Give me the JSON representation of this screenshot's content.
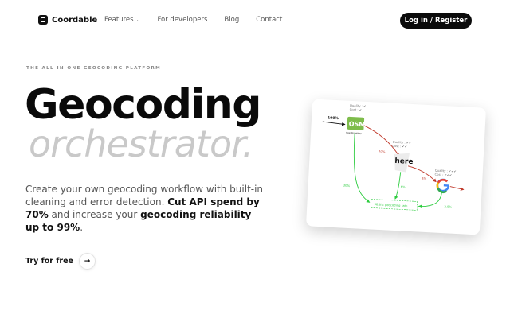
{
  "nav": {
    "brand": "Coordable",
    "links": [
      {
        "label": "Features",
        "has_dropdown": true
      },
      {
        "label": "For developers"
      },
      {
        "label": "Blog"
      },
      {
        "label": "Contact"
      }
    ],
    "login_label": "Log in / Register"
  },
  "hero": {
    "eyebrow": "THE ALL-IN-ONE GEOCODING PLATFORM",
    "title_line1": "Geocoding",
    "title_line2": "orchestrator.",
    "desc_part1": "Create your own geocoding workflow with built-in cleaning and error detection. ",
    "desc_bold1": "Cut API spend by 70%",
    "desc_part2": " and increase your ",
    "desc_bold2": "geocoding reliability up to 99%",
    "desc_part3": ".",
    "cta_label": "Try for free"
  },
  "diagram": {
    "input_pct": "100%",
    "osm_label": "OSM",
    "osm_sub": "OpenStreetMap",
    "osm_quality": "Quality : ✔",
    "osm_cost": "Cost : ✔",
    "here_label": "here",
    "here_quality": "Quality : ✔✔",
    "here_cost": "Cost : ✔✔",
    "google_quality": "Quality : ✔✔✔",
    "google_cost": "Cost : ✔✔✔",
    "pct_osm_to_here": "70%",
    "pct_here_to_google": "4%",
    "pct_osm_ok": "30%",
    "pct_here_ok": "6%",
    "pct_google_ok": "2.8%",
    "result_label": "98.8% geocoding rate",
    "colors": {
      "red": "#c0392b",
      "green": "#2ecc40",
      "black": "#111111"
    }
  }
}
